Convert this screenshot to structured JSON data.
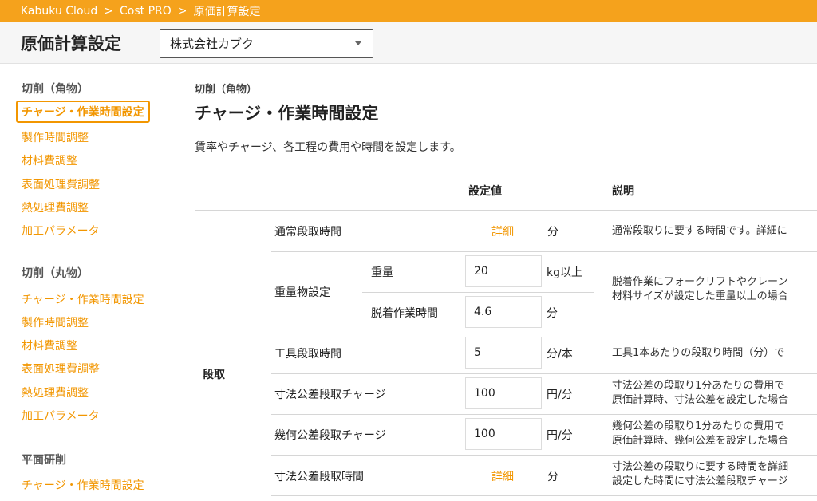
{
  "breadcrumb": {
    "items": [
      "Kabuku Cloud",
      "Cost PRO",
      "原価計算設定"
    ],
    "separator": ">"
  },
  "header": {
    "title": "原価計算設定",
    "company": "株式会社カブク"
  },
  "sidebar": {
    "groups": [
      {
        "title": "切削（角物）",
        "items": [
          "チャージ・作業時間設定",
          "製作時間調整",
          "材料費調整",
          "表面処理費調整",
          "熱処理費調整",
          "加工パラメータ"
        ]
      },
      {
        "title": "切削（丸物）",
        "items": [
          "チャージ・作業時間設定",
          "製作時間調整",
          "材料費調整",
          "表面処理費調整",
          "熱処理費調整",
          "加工パラメータ"
        ]
      },
      {
        "title": "平面研削",
        "items": [
          "チャージ・作業時間設定"
        ]
      }
    ]
  },
  "main": {
    "category": "切削（角物）",
    "title": "チャージ・作業時間設定",
    "description": "賃率やチャージ、各工程の費用や時間を設定します。",
    "table": {
      "headers": {
        "value": "設定値",
        "explain": "説明"
      },
      "group_label": "段取",
      "rows": [
        {
          "label": "通常段取時間",
          "detail": "詳細",
          "unit": "分",
          "desc1": "通常段取りに要する時間です。詳細に"
        },
        {
          "label": "重量物設定",
          "sub": [
            {
              "label": "重量",
              "value": "20",
              "unit": "kg以上"
            },
            {
              "label": "脱着作業時間",
              "value": "4.6",
              "unit": "分"
            }
          ],
          "desc1": "脱着作業にフォークリフトやクレーン",
          "desc2": "材料サイズが設定した重量以上の場合"
        },
        {
          "label": "工具段取時間",
          "value": "5",
          "unit": "分/本",
          "desc1": "工具1本あたりの段取り時間（分）で"
        },
        {
          "label": "寸法公差段取チャージ",
          "value": "100",
          "unit": "円/分",
          "desc1": "寸法公差の段取り1分あたりの費用で",
          "desc2": "原価計算時、寸法公差を設定した場合"
        },
        {
          "label": "幾何公差段取チャージ",
          "value": "100",
          "unit": "円/分",
          "desc1": "幾何公差の段取り1分あたりの費用で",
          "desc2": "原価計算時、幾何公差を設定した場合"
        },
        {
          "label": "寸法公差段取時間",
          "detail": "詳細",
          "unit": "分",
          "desc1": "寸法公差の段取りに要する時間を詳細",
          "desc2": "設定した時間に寸法公差段取チャージ"
        }
      ]
    }
  },
  "colors": {
    "accent": "#f29600",
    "topbar": "#f5a21c"
  }
}
